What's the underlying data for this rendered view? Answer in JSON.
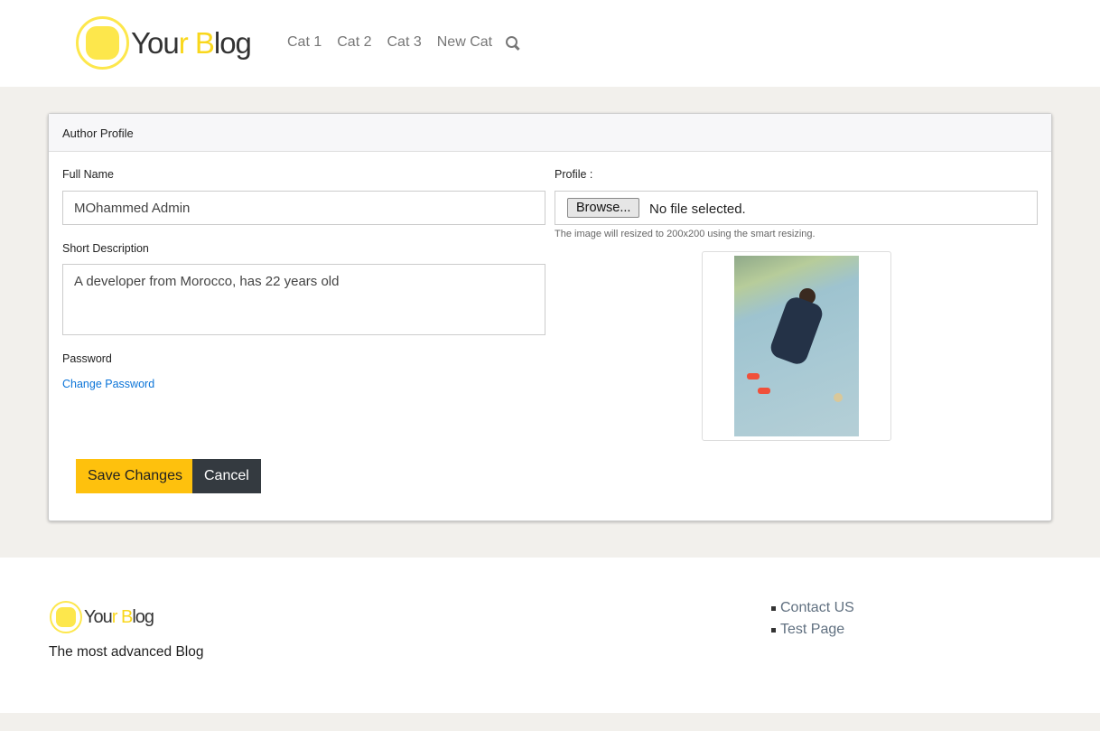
{
  "header": {
    "logo_text_a": "You",
    "logo_text_b": "r ",
    "logo_text_c": "B",
    "logo_text_d": "log",
    "nav": [
      "Cat 1",
      "Cat 2",
      "Cat 3",
      "New Cat"
    ]
  },
  "card": {
    "title": "Author Profile",
    "full_name_label": "Full Name",
    "full_name_value": "MOhammed Admin",
    "short_desc_label": "Short Description",
    "short_desc_value": "A developer from Morocco, has 22 years old",
    "password_label": "Password",
    "change_password": "Change Password",
    "profile_label": "Profile :",
    "browse": "Browse...",
    "no_file": "No file selected.",
    "hint": "The image will resized to 200x200 using the smart resizing.",
    "save": "Save Changes",
    "cancel": "Cancel"
  },
  "footer": {
    "tagline": "The most advanced Blog",
    "links": [
      "Contact US",
      "Test Page"
    ]
  }
}
